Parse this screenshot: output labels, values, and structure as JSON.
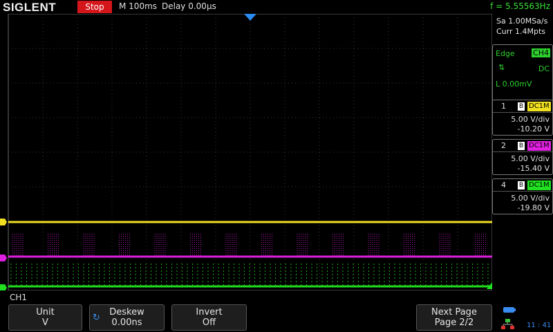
{
  "header": {
    "logo": "SIGLENT",
    "run_state": "Stop",
    "timebase": "M 100ms",
    "delay": "Delay 0.00µs",
    "frequency": "f = 5.55563Hz"
  },
  "acquisition": {
    "sample_rate": "Sa 1.00MSa/s",
    "memory_depth": "Curr 1.4Mpts"
  },
  "trigger": {
    "type": "Edge",
    "source": "CH4",
    "slope_icon": "rise-fall-slope-icon",
    "coupling": "DC",
    "level": "L  0.00mV"
  },
  "channels": [
    {
      "num": "1",
      "coupling": "DC1M",
      "vdiv": "5.00 V/div",
      "offset": "-10.20 V",
      "color": "#f0e020"
    },
    {
      "num": "2",
      "coupling": "DC1M",
      "vdiv": "5.00 V/div",
      "offset": "-15.40 V",
      "color": "#e020e0"
    },
    {
      "num": "4",
      "coupling": "DC1M",
      "vdiv": "5.00 V/div",
      "offset": "-19.80 V",
      "color": "#20e020"
    }
  ],
  "menu": {
    "channel_label": "CH1",
    "softkeys": [
      {
        "title": "Unit",
        "value": "V"
      },
      {
        "title": "Deskew",
        "value": "0.00ns"
      },
      {
        "title": "Invert",
        "value": "Off"
      },
      {
        "title": "Next Page",
        "value": "Page 2/2"
      }
    ]
  },
  "status": {
    "clock": "11 : 41"
  }
}
